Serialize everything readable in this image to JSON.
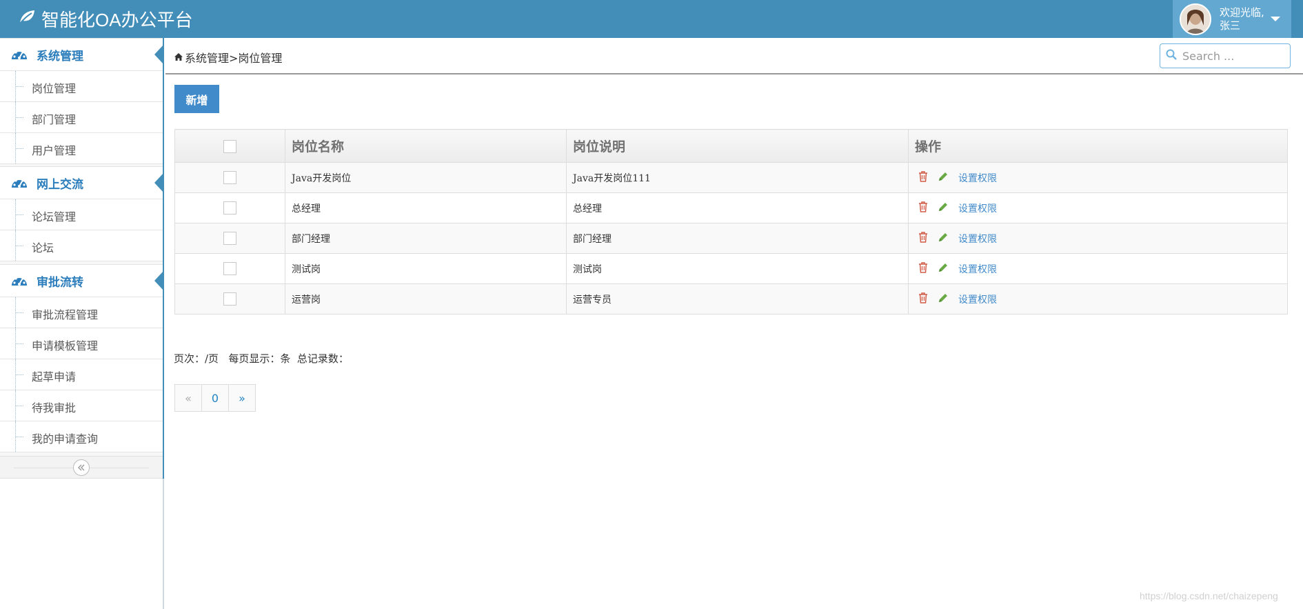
{
  "header": {
    "brand": "智能化OA办公平台",
    "welcome": "欢迎光临,",
    "username": "张三"
  },
  "sidebar": {
    "groups": [
      {
        "label": "系统管理",
        "items": [
          "岗位管理",
          "部门管理",
          "用户管理"
        ]
      },
      {
        "label": "网上交流",
        "items": [
          "论坛管理",
          "论坛"
        ]
      },
      {
        "label": "审批流转",
        "items": [
          "审批流程管理",
          "申请模板管理",
          "起草申请",
          "待我审批",
          "我的申请查询"
        ]
      }
    ],
    "collapse_icon": "double-chevron-left-icon"
  },
  "breadcrumb": {
    "home_icon": "home-icon",
    "text": "系统管理>岗位管理"
  },
  "search": {
    "placeholder": "Search ..."
  },
  "toolbar": {
    "add_label": "新增"
  },
  "table": {
    "columns": [
      "岗位名称",
      "岗位说明",
      "操作"
    ],
    "rows": [
      {
        "name": "Java开发岗位",
        "desc": "Java开发岗位111"
      },
      {
        "name": "总经理",
        "desc": "总经理"
      },
      {
        "name": "部门经理",
        "desc": "部门经理"
      },
      {
        "name": "测试岗",
        "desc": "测试岗"
      },
      {
        "name": "运营岗",
        "desc": "运营专员"
      }
    ],
    "action_permission_label": "设置权限",
    "delete_color": "#d15b47",
    "edit_color": "#69aa46"
  },
  "pagination": {
    "info": "页次：/页   每页显示：条  总记录数：",
    "prev": "«",
    "current": "0",
    "next": "»"
  },
  "watermark": "https://blog.csdn.net/chaizepeng",
  "colors": {
    "navbar": "#438eb9",
    "user_box": "#62a8d1",
    "accent": "#2b7dbc",
    "primary_button": "#428bca"
  }
}
